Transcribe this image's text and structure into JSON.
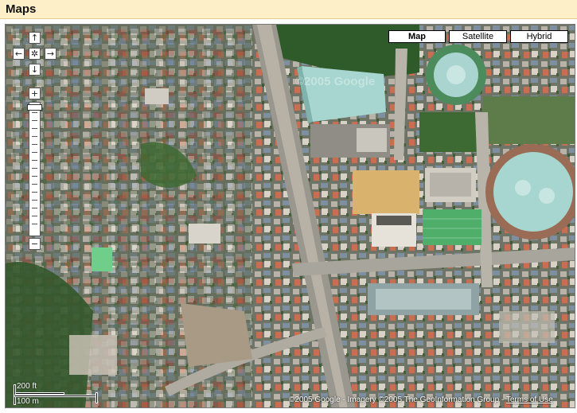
{
  "header": {
    "title": "Maps"
  },
  "map": {
    "type_controls": [
      {
        "label": "Map",
        "active": true
      },
      {
        "label": "Satellite",
        "active": false
      },
      {
        "label": "Hybrid",
        "active": false
      }
    ],
    "nav": {
      "up": "↑",
      "down": "↓",
      "left": "←",
      "right": "→",
      "center": "✲"
    },
    "zoom": {
      "in": "+",
      "out": "−"
    },
    "scale": {
      "top_label": "200 ft",
      "bottom_label": "100 m"
    },
    "watermark": "©2005 Google",
    "copyright": {
      "text": "©2005 Google - Imagery ©2005 The GeoInformation Group - ",
      "terms_label": "Terms of Use"
    }
  },
  "colors": {
    "header_bg": "#fdf0c9",
    "roof_teal": "#a6d6cf",
    "field_sand": "#d9b36e",
    "field_green": "#4fae6a",
    "vegetation": "#3e6b34",
    "road": "#b7b1a6"
  }
}
